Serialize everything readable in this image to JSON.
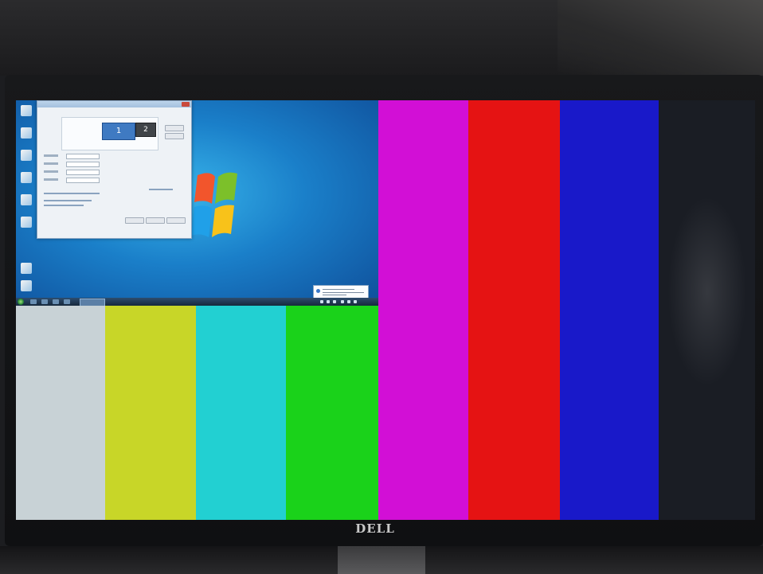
{
  "monitor": {
    "brand": "DELL"
  },
  "colors": {
    "bar_gray": "#c8d2d6",
    "bar_yellow": "#c8d628",
    "bar_cyan": "#22d0d2",
    "bar_green": "#1ad21a",
    "bar_magenta": "#d20fd6",
    "bar_red": "#e51313",
    "bar_blue": "#1919c9",
    "bar_dark": "#1a1d24"
  },
  "dialog": {
    "monitor_1_label": "1",
    "monitor_2_label": "2"
  },
  "icons": {
    "start": "windows-start-orb-icon",
    "logo": "windows-7-logo-icon"
  }
}
